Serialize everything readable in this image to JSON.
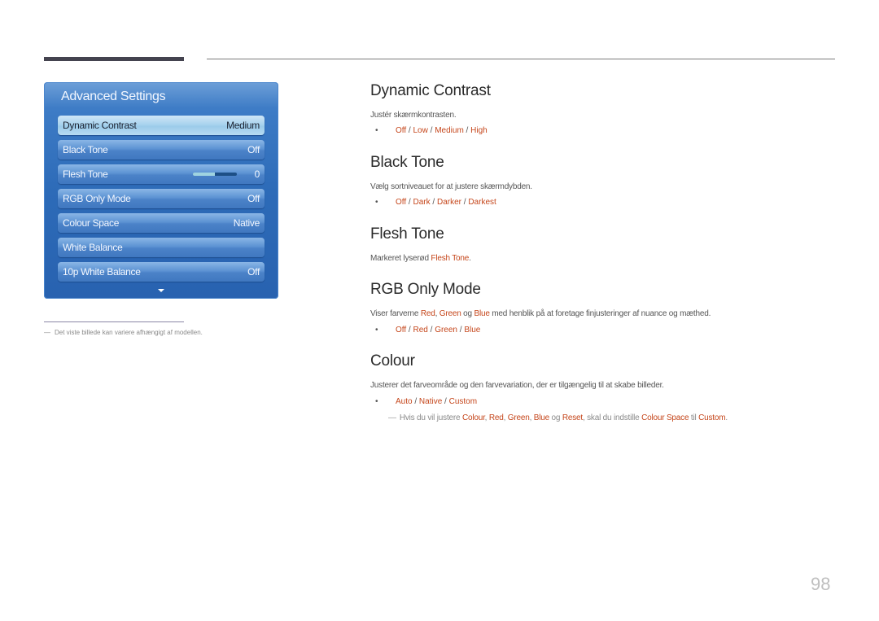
{
  "osd": {
    "title": "Advanced Settings",
    "items": [
      {
        "label": "Dynamic Contrast",
        "value": "Medium",
        "selected": true
      },
      {
        "label": "Black Tone",
        "value": "Off"
      },
      {
        "label": "Flesh Tone",
        "value": "0",
        "slider_fraction": 0.5
      },
      {
        "label": "RGB Only Mode",
        "value": "Off"
      },
      {
        "label": "Colour Space",
        "value": "Native"
      },
      {
        "label": "White Balance",
        "value": ""
      },
      {
        "label": "10p White Balance",
        "value": "Off"
      }
    ]
  },
  "footnote": {
    "dash": "―",
    "text": "Det viste billede kan variere afhængigt af modellen."
  },
  "sections": {
    "dynamic_contrast": {
      "title": "Dynamic Contrast",
      "desc": "Justér skærmkontrasten.",
      "options": [
        "Off",
        "Low",
        "Medium",
        "High"
      ]
    },
    "black_tone": {
      "title": "Black Tone",
      "desc": "Vælg sortniveauet for at justere skærmdybden.",
      "options": [
        "Off",
        "Dark",
        "Darker",
        "Darkest"
      ]
    },
    "flesh_tone": {
      "title": "Flesh Tone",
      "desc_prefix": "Markeret lyserød ",
      "desc_hl": "Flesh Tone",
      "desc_suffix": "."
    },
    "rgb_only": {
      "title": "RGB Only Mode",
      "desc_prefix": "Viser farverne ",
      "hl1": "Red",
      "sep1": ", ",
      "hl2": "Green",
      "sep2": " og ",
      "hl3": "Blue",
      "desc_suffix": " med henblik på at foretage finjusteringer af nuance og mæthed.",
      "options": [
        "Off",
        "Red",
        "Green",
        "Blue"
      ]
    },
    "colour": {
      "title": "Colour",
      "desc": "Justerer det farveområde og den farvevariation, der er tilgængelig til at skabe billeder.",
      "options": [
        "Auto",
        "Native",
        "Custom"
      ],
      "note": {
        "dash": "―",
        "t1": "Hvis du vil justere ",
        "h1": "Colour",
        "t2": ", ",
        "h2": "Red",
        "t3": ", ",
        "h3": "Green",
        "t4": ", ",
        "h4": "Blue",
        "t5": " og ",
        "h5": "Reset",
        "t6": ", skal du indstille ",
        "h6": "Colour Space",
        "t7": " til ",
        "h7": "Custom",
        "t8": "."
      }
    }
  },
  "bullet": "•",
  "separator": " / ",
  "page_number": "98",
  "colors": {
    "highlight": "#c5461b",
    "osd_blue": "#2d6bb8"
  }
}
